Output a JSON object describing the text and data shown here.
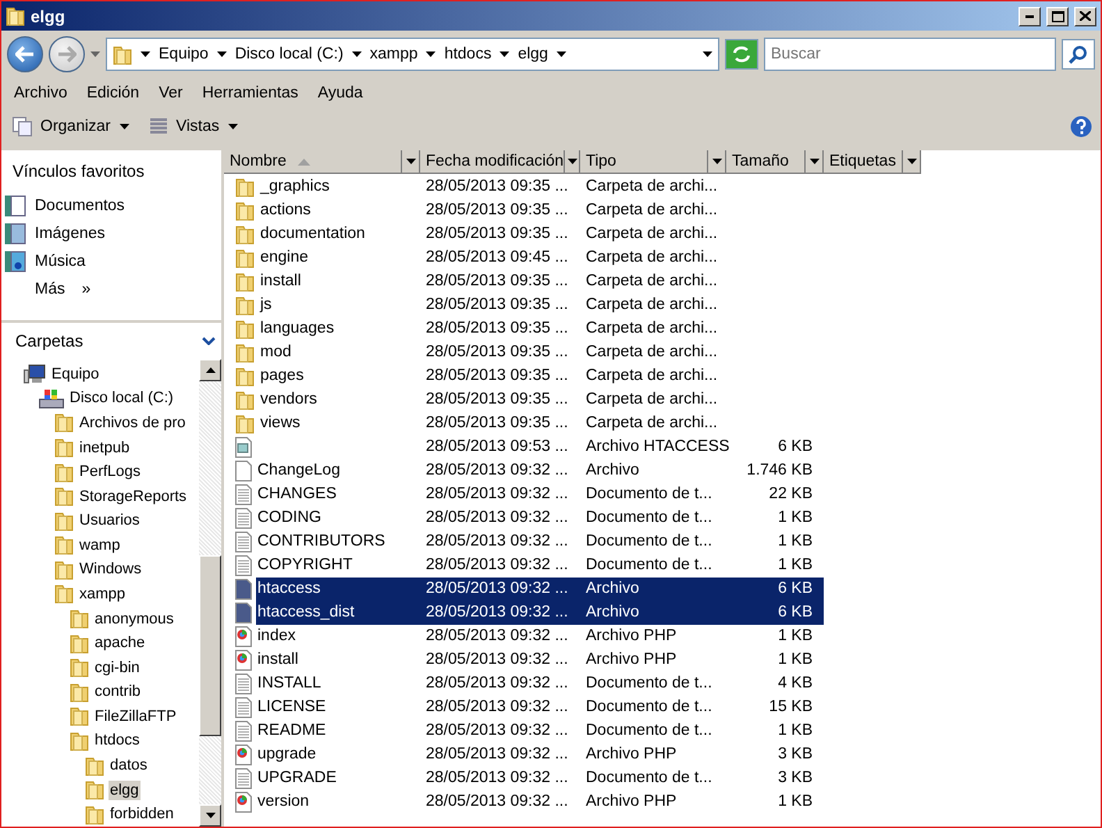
{
  "window": {
    "title": "elgg"
  },
  "address": {
    "crumbs": [
      "Equipo",
      "Disco local (C:)",
      "xampp",
      "htdocs",
      "elgg"
    ]
  },
  "search": {
    "placeholder": "Buscar"
  },
  "menu": [
    "Archivo",
    "Edición",
    "Ver",
    "Herramientas",
    "Ayuda"
  ],
  "toolbar": [
    {
      "label": "Organizar",
      "kind": "organize"
    },
    {
      "label": "Vistas",
      "kind": "views"
    }
  ],
  "favorites": {
    "title": "Vínculos favoritos",
    "items": [
      {
        "label": "Documentos",
        "kind": "documents"
      },
      {
        "label": "Imágenes",
        "kind": "pictures"
      },
      {
        "label": "Música",
        "kind": "music"
      }
    ],
    "more": {
      "label": "Más",
      "glyph": "»"
    }
  },
  "folders": {
    "title": "Carpetas",
    "tree": [
      {
        "label": "Equipo",
        "kind": "computer",
        "selected": false,
        "children": [
          {
            "label": "Disco local (C:)",
            "kind": "drive",
            "selected": false,
            "children": [
              {
                "label": "Archivos de pro",
                "kind": "folder",
                "selected": false
              },
              {
                "label": "inetpub",
                "kind": "folder",
                "selected": false
              },
              {
                "label": "PerfLogs",
                "kind": "folder",
                "selected": false
              },
              {
                "label": "StorageReports",
                "kind": "folder",
                "selected": false
              },
              {
                "label": "Usuarios",
                "kind": "folder",
                "selected": false
              },
              {
                "label": "wamp",
                "kind": "folder",
                "selected": false
              },
              {
                "label": "Windows",
                "kind": "folder",
                "selected": false
              },
              {
                "label": "xampp",
                "kind": "folder",
                "selected": false,
                "children": [
                  {
                    "label": "anonymous",
                    "kind": "folder",
                    "selected": false
                  },
                  {
                    "label": "apache",
                    "kind": "folder",
                    "selected": false
                  },
                  {
                    "label": "cgi-bin",
                    "kind": "folder",
                    "selected": false
                  },
                  {
                    "label": "contrib",
                    "kind": "folder",
                    "selected": false
                  },
                  {
                    "label": "FileZillaFTP",
                    "kind": "folder",
                    "selected": false
                  },
                  {
                    "label": "htdocs",
                    "kind": "folder",
                    "selected": false,
                    "children": [
                      {
                        "label": "datos",
                        "kind": "folder",
                        "selected": false
                      },
                      {
                        "label": "elgg",
                        "kind": "folder",
                        "selected": true
                      },
                      {
                        "label": "forbidden",
                        "kind": "folder",
                        "selected": false
                      }
                    ]
                  }
                ]
              }
            ]
          }
        ]
      }
    ]
  },
  "table": {
    "columns": [
      {
        "label": "Nombre",
        "sorted": true
      },
      {
        "label": "Fecha modificación",
        "sorted": false
      },
      {
        "label": "Tipo",
        "sorted": false
      },
      {
        "label": "Tamaño",
        "sorted": false
      },
      {
        "label": "Etiquetas",
        "sorted": false
      }
    ],
    "rows": [
      {
        "name": "_graphics",
        "date": "28/05/2013 09:35 ...",
        "type": "Carpeta de archi...",
        "kind": "folder",
        "selected": false
      },
      {
        "name": "actions",
        "date": "28/05/2013 09:35 ...",
        "type": "Carpeta de archi...",
        "kind": "folder",
        "selected": false
      },
      {
        "name": "documentation",
        "date": "28/05/2013 09:35 ...",
        "type": "Carpeta de archi...",
        "kind": "folder",
        "selected": false
      },
      {
        "name": "engine",
        "date": "28/05/2013 09:45 ...",
        "type": "Carpeta de archi...",
        "kind": "folder",
        "selected": false
      },
      {
        "name": "install",
        "date": "28/05/2013 09:35 ...",
        "type": "Carpeta de archi...",
        "kind": "folder",
        "selected": false
      },
      {
        "name": "js",
        "date": "28/05/2013 09:35 ...",
        "type": "Carpeta de archi...",
        "kind": "folder",
        "selected": false
      },
      {
        "name": "languages",
        "date": "28/05/2013 09:35 ...",
        "type": "Carpeta de archi...",
        "kind": "folder",
        "selected": false
      },
      {
        "name": "mod",
        "date": "28/05/2013 09:35 ...",
        "type": "Carpeta de archi...",
        "kind": "folder",
        "selected": false
      },
      {
        "name": "pages",
        "date": "28/05/2013 09:35 ...",
        "type": "Carpeta de archi...",
        "kind": "folder",
        "selected": false
      },
      {
        "name": "vendors",
        "date": "28/05/2013 09:35 ...",
        "type": "Carpeta de archi...",
        "kind": "folder",
        "selected": false
      },
      {
        "name": "views",
        "date": "28/05/2013 09:35 ...",
        "type": "Carpeta de archi...",
        "kind": "folder",
        "selected": false
      },
      {
        "date": "28/05/2013 09:53 ...",
        "type": "Archivo HTACCESS",
        "size": "6 KB",
        "kind": "config",
        "selected": false
      },
      {
        "name": "ChangeLog",
        "date": "28/05/2013 09:32 ...",
        "type": "Archivo",
        "size": "1.746 KB",
        "kind": "file",
        "selected": false
      },
      {
        "name": "CHANGES",
        "date": "28/05/2013 09:32 ...",
        "type": "Documento de t...",
        "size": "22 KB",
        "kind": "text",
        "selected": false
      },
      {
        "name": "CODING",
        "date": "28/05/2013 09:32 ...",
        "type": "Documento de t...",
        "size": "1 KB",
        "kind": "text",
        "selected": false
      },
      {
        "name": "CONTRIBUTORS",
        "date": "28/05/2013 09:32 ...",
        "type": "Documento de t...",
        "size": "1 KB",
        "kind": "text",
        "selected": false
      },
      {
        "name": "COPYRIGHT",
        "date": "28/05/2013 09:32 ...",
        "type": "Documento de t...",
        "size": "1 KB",
        "kind": "text",
        "selected": false
      },
      {
        "name": "htaccess",
        "date": "28/05/2013 09:32 ...",
        "type": "Archivo",
        "size": "6 KB",
        "kind": "file",
        "selected": true
      },
      {
        "name": "htaccess_dist",
        "date": "28/05/2013 09:32 ...",
        "type": "Archivo",
        "size": "6 KB",
        "kind": "file",
        "selected": true
      },
      {
        "name": "index",
        "date": "28/05/2013 09:32 ...",
        "type": "Archivo PHP",
        "size": "1 KB",
        "kind": "php",
        "selected": false
      },
      {
        "name": "install",
        "date": "28/05/2013 09:32 ...",
        "type": "Archivo PHP",
        "size": "1 KB",
        "kind": "php",
        "selected": false
      },
      {
        "name": "INSTALL",
        "date": "28/05/2013 09:32 ...",
        "type": "Documento de t...",
        "size": "4 KB",
        "kind": "text",
        "selected": false
      },
      {
        "name": "LICENSE",
        "date": "28/05/2013 09:32 ...",
        "type": "Documento de t...",
        "size": "15 KB",
        "kind": "text",
        "selected": false
      },
      {
        "name": "README",
        "date": "28/05/2013 09:32 ...",
        "type": "Documento de t...",
        "size": "1 KB",
        "kind": "text",
        "selected": false
      },
      {
        "name": "upgrade",
        "date": "28/05/2013 09:32 ...",
        "type": "Archivo PHP",
        "size": "3 KB",
        "kind": "php",
        "selected": false
      },
      {
        "name": "UPGRADE",
        "date": "28/05/2013 09:32 ...",
        "type": "Documento de t...",
        "size": "3 KB",
        "kind": "text",
        "selected": false
      },
      {
        "name": "version",
        "date": "28/05/2013 09:32 ...",
        "type": "Archivo PHP",
        "size": "1 KB",
        "kind": "php",
        "selected": false
      }
    ]
  }
}
